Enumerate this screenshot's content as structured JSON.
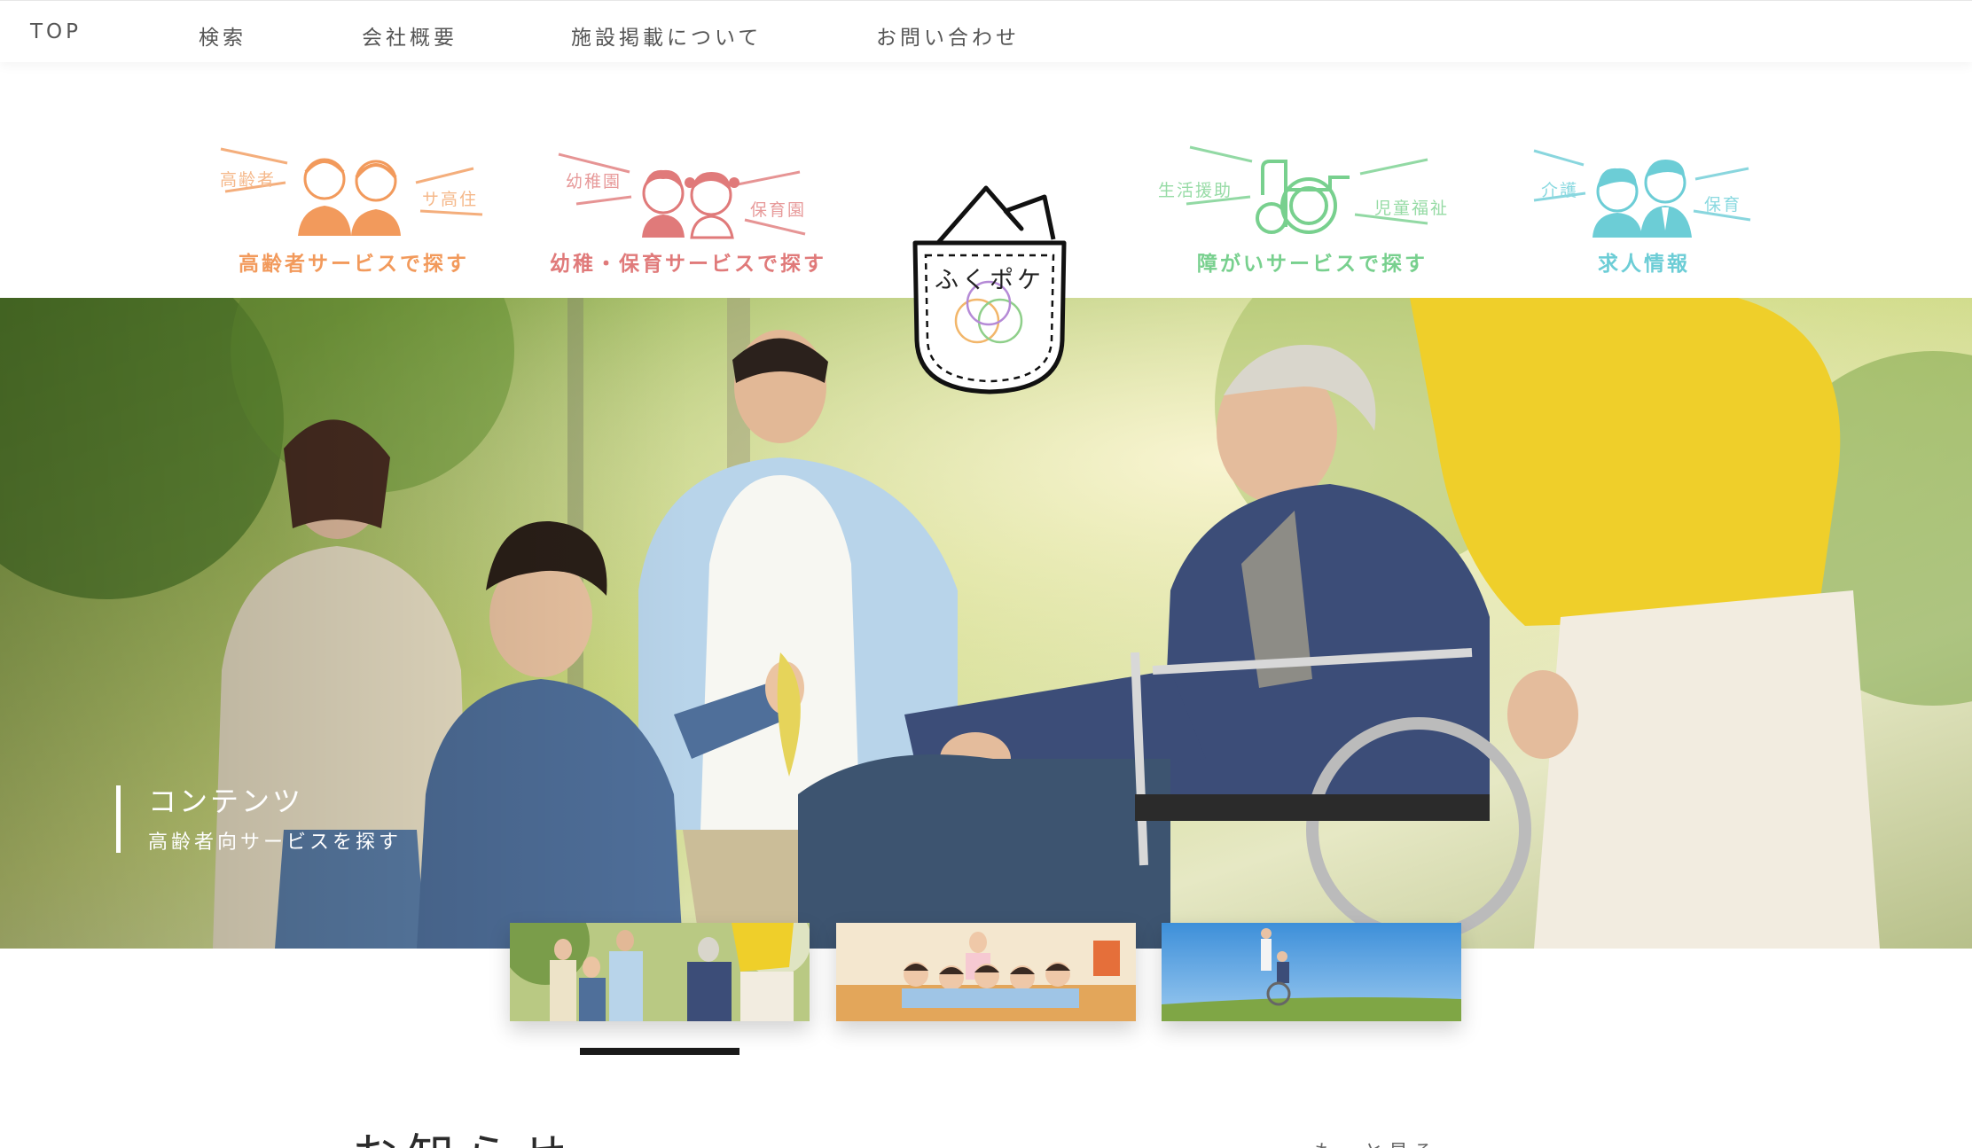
{
  "nav": {
    "items": [
      "TOP",
      "検索",
      "会社概要",
      "施設掲載について",
      "お問い合わせ"
    ]
  },
  "categories": [
    {
      "label": "高齢者サービスで探す",
      "tags": [
        "高齢者",
        "サ高住"
      ],
      "color": "#f29a5c"
    },
    {
      "label": "幼稚・保育サービスで探す",
      "tags": [
        "幼稚園",
        "保育園"
      ],
      "color": "#e07a7a"
    },
    {
      "label": "障がいサービスで探す",
      "tags": [
        "生活援助",
        "児童福祉"
      ],
      "color": "#78d08e"
    },
    {
      "label": "求人情報",
      "tags": [
        "介護",
        "保育"
      ],
      "color": "#6ccdd6"
    }
  ],
  "logo": {
    "text": "ふくポケ"
  },
  "hero": {
    "caption_title": "コンテンツ",
    "caption_sub": "高齢者向サービスを探す"
  },
  "thumbnails": [
    {
      "name": "family-outdoor",
      "active": true
    },
    {
      "name": "kids-classroom",
      "active": false
    },
    {
      "name": "wheelchair-sky",
      "active": false
    }
  ],
  "news": {
    "title": "お知らせ",
    "more": "もっと見る"
  }
}
